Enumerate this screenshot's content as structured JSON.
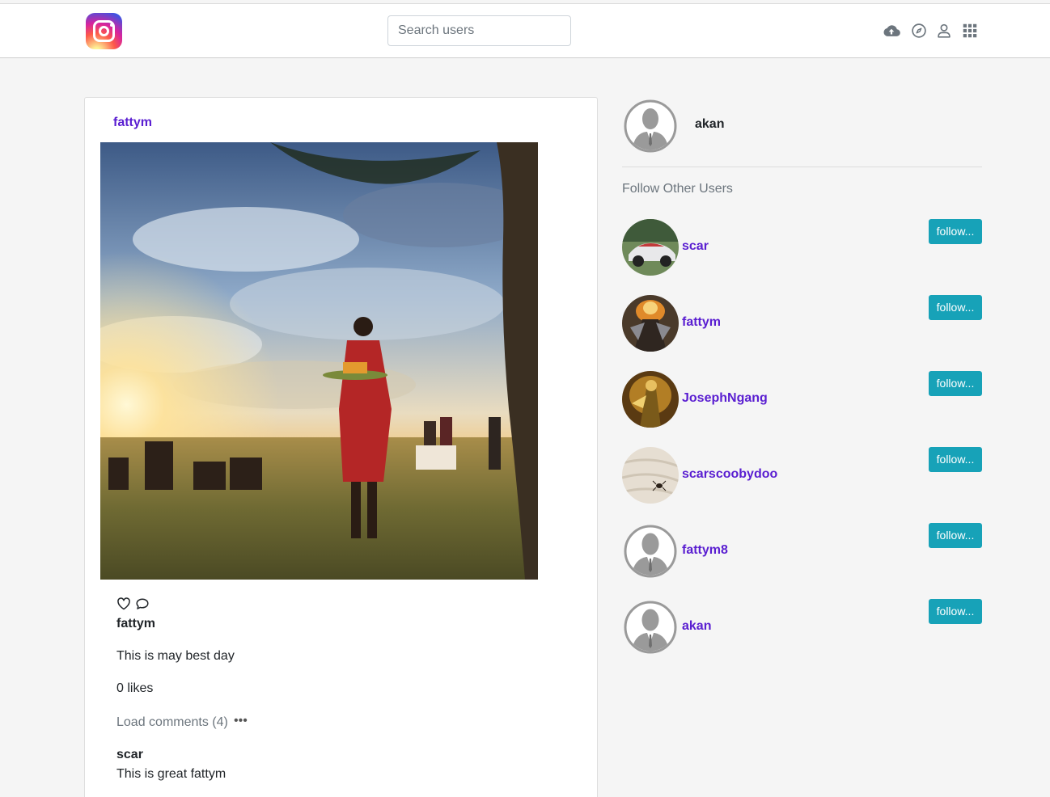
{
  "header": {
    "search_placeholder": "Search users",
    "icons": [
      "upload-cloud-icon",
      "compass-icon",
      "user-icon",
      "grid-icon"
    ]
  },
  "post": {
    "username": "fattym",
    "author": "fattym",
    "caption": "This is may best day",
    "likes": "0 likes",
    "load_comments": "Load comments (4)",
    "more": "•••",
    "comments": [
      {
        "user": "scar",
        "text": "This is great fattym"
      }
    ]
  },
  "sidebar": {
    "current_user": "akan",
    "suggest_title": "Follow Other Users",
    "follow_label": "follow...",
    "suggestions": [
      {
        "username": "scar"
      },
      {
        "username": "fattym"
      },
      {
        "username": "JosephNgang"
      },
      {
        "username": "scarscoobydoo"
      },
      {
        "username": "fattym8"
      },
      {
        "username": "akan"
      }
    ]
  },
  "colors": {
    "username_link": "#5a1ed1",
    "follow_button": "#17a2b8",
    "page_bg": "#f5f5f5"
  }
}
